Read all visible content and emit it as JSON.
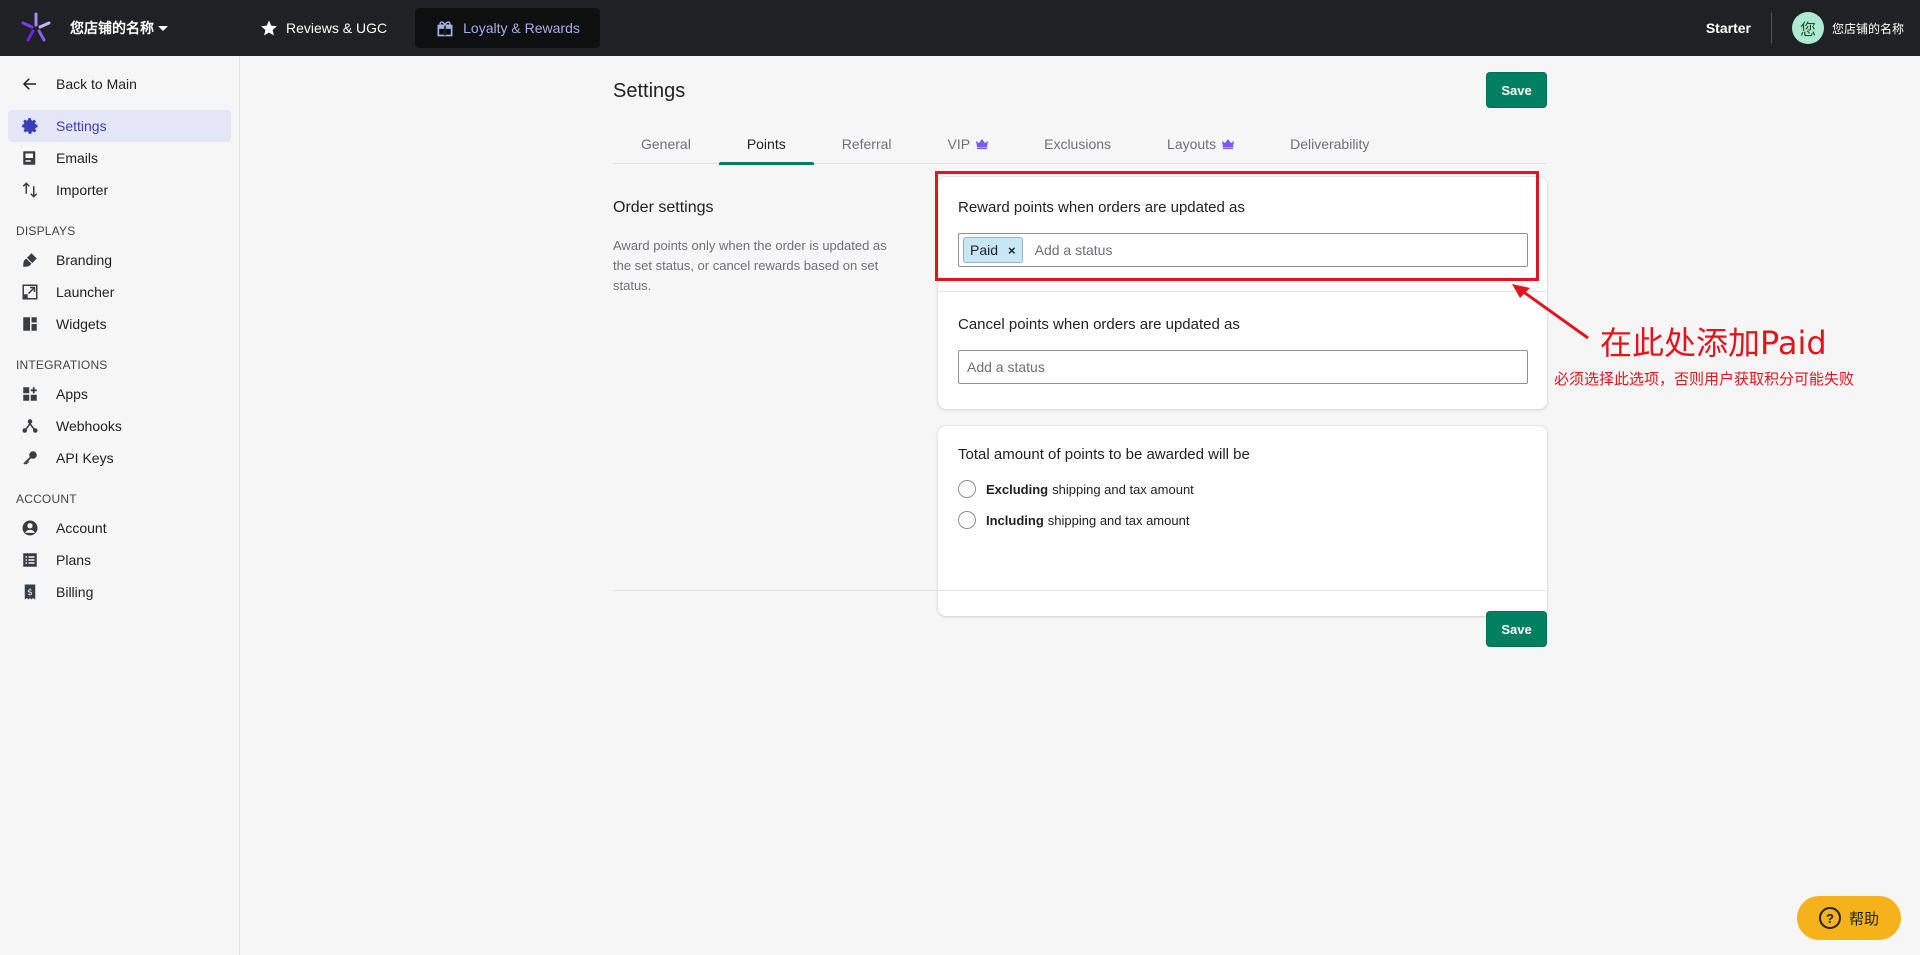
{
  "topbar": {
    "store_name": "您店铺的名称",
    "tabs": [
      {
        "label": "Reviews & UGC",
        "icon": "star-icon"
      },
      {
        "label": "Loyalty & Rewards",
        "icon": "gift-icon"
      }
    ],
    "plan": "Starter",
    "avatar_initial": "您",
    "user_name": "您店铺的名称"
  },
  "sidebar": {
    "back_label": "Back to Main",
    "main_items": [
      {
        "label": "Settings",
        "icon": "gear-icon"
      },
      {
        "label": "Emails",
        "icon": "email-icon"
      },
      {
        "label": "Importer",
        "icon": "import-icon"
      }
    ],
    "displays_heading": "DISPLAYS",
    "displays_items": [
      {
        "label": "Branding",
        "icon": "brush-icon"
      },
      {
        "label": "Launcher",
        "icon": "launcher-icon"
      },
      {
        "label": "Widgets",
        "icon": "widgets-icon"
      }
    ],
    "integrations_heading": "INTEGRATIONS",
    "integrations_items": [
      {
        "label": "Apps",
        "icon": "apps-icon"
      },
      {
        "label": "Webhooks",
        "icon": "webhook-icon"
      },
      {
        "label": "API Keys",
        "icon": "key-icon"
      }
    ],
    "account_heading": "ACCOUNT",
    "account_items": [
      {
        "label": "Account",
        "icon": "user-icon"
      },
      {
        "label": "Plans",
        "icon": "list-icon"
      },
      {
        "label": "Billing",
        "icon": "receipt-icon"
      }
    ]
  },
  "main": {
    "title": "Settings",
    "save_label": "Save",
    "tabs": [
      {
        "label": "General"
      },
      {
        "label": "Points"
      },
      {
        "label": "Referral"
      },
      {
        "label": "VIP"
      },
      {
        "label": "Exclusions"
      },
      {
        "label": "Layouts"
      },
      {
        "label": "Deliverability"
      }
    ],
    "section_title": "Order settings",
    "section_desc": "Award points only when the order is updated as the set status, or cancel rewards based on set status.",
    "reward_label": "Reward points when orders are updated as",
    "reward_tag": "Paid",
    "reward_tag_remove": "×",
    "status_placeholder": "Add a status",
    "cancel_label": "Cancel points when orders are updated as",
    "total_label": "Total amount of points to be awarded will be",
    "option_excluding_bold": "Excluding",
    "option_excluding_rest": "shipping and tax amount",
    "option_including_bold": "Including",
    "option_including_rest": "shipping and tax amount"
  },
  "annotation": {
    "title": "在此处添加Paid",
    "note": "必须选择此选项，否则用户获取积分可能失败"
  },
  "help": {
    "label": "帮助",
    "icon_glyph": "?"
  },
  "colors": {
    "accent": "#008060",
    "annotation": "#e0161f",
    "active_nav": "#3b3fb6",
    "help": "#f6b21a"
  }
}
